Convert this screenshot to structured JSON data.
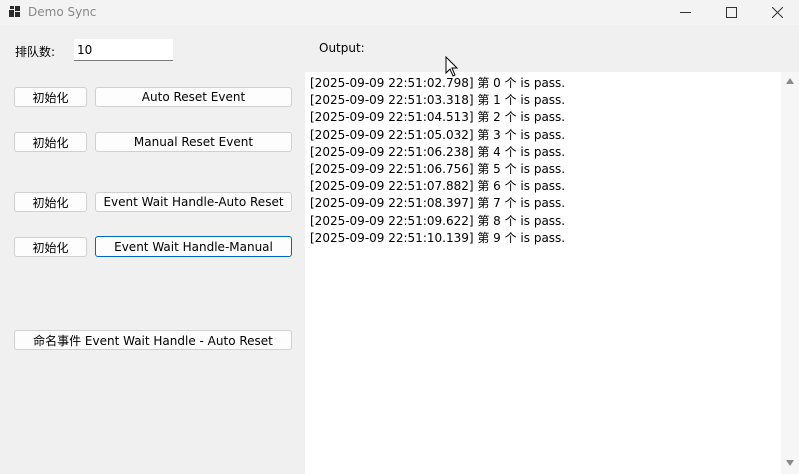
{
  "window": {
    "title": "Demo Sync",
    "icon": "app-window-icon",
    "controls": [
      "minimize-icon",
      "maximize-icon",
      "close-icon"
    ]
  },
  "form": {
    "queue_label": "排队数:",
    "queue_value": "10",
    "output_label": "Output:"
  },
  "buttons": {
    "init_label": "初始化",
    "auto_reset": "Auto Reset Event",
    "manual_reset": "Manual Reset Event",
    "ewh_auto": "Event Wait Handle-Auto Reset",
    "ewh_manual": "Event Wait Handle-Manual",
    "named_event": "命名事件 Event Wait Handle - Auto Reset"
  },
  "output_lines": [
    "[2025-09-09 22:51:02.798] 第  0  个 is pass.",
    "[2025-09-09 22:51:03.318] 第  1  个 is pass.",
    "[2025-09-09 22:51:04.513] 第  2  个 is pass.",
    "[2025-09-09 22:51:05.032] 第  3  个 is pass.",
    "[2025-09-09 22:51:06.238] 第  4  个 is pass.",
    "[2025-09-09 22:51:06.756] 第  5  个 is pass.",
    "[2025-09-09 22:51:07.882] 第  6  个 is pass.",
    "[2025-09-09 22:51:08.397] 第  7  个 is pass.",
    "[2025-09-09 22:51:09.622] 第  8  个 is pass.",
    "[2025-09-09 22:51:10.139] 第  9  个 is pass."
  ],
  "colors": {
    "focus": "#0067c0",
    "window_bg": "#f0f0f0"
  }
}
